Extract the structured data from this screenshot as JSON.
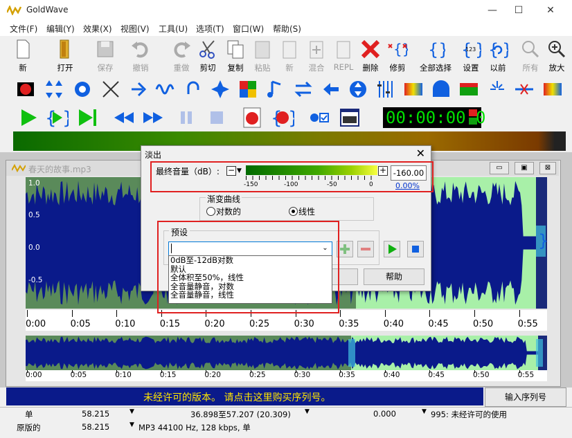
{
  "window": {
    "title": "GoldWave"
  },
  "menu": [
    "文件(F)",
    "编辑(Y)",
    "效果(X)",
    "视图(V)",
    "工具(U)",
    "选项(T)",
    "窗口(W)",
    "帮助(S)"
  ],
  "toolbar": [
    {
      "label": "新",
      "icon": "new-file-icon",
      "enabled": true
    },
    {
      "label": "打开",
      "icon": "open-folder-icon",
      "enabled": true
    },
    {
      "label": "保存",
      "icon": "save-icon",
      "enabled": false
    },
    {
      "label": "撤销",
      "icon": "undo-icon",
      "enabled": false
    },
    {
      "label": "重做",
      "icon": "redo-icon",
      "enabled": false
    },
    {
      "label": "剪切",
      "icon": "scissors-icon",
      "enabled": true
    },
    {
      "label": "复制",
      "icon": "copy-icon",
      "enabled": true
    },
    {
      "label": "粘贴",
      "icon": "paste-icon",
      "enabled": false
    },
    {
      "label": "新",
      "icon": "paste-new-icon",
      "enabled": false
    },
    {
      "label": "混合",
      "icon": "mix-icon",
      "enabled": false
    },
    {
      "label": "REPL",
      "icon": "replace-icon",
      "enabled": false
    },
    {
      "label": "删除",
      "icon": "delete-x-icon",
      "enabled": true
    },
    {
      "label": "修剪",
      "icon": "trim-icon",
      "enabled": true
    },
    {
      "label": "全部选择",
      "icon": "select-all-icon",
      "enabled": true
    },
    {
      "label": "设置",
      "icon": "set-icon",
      "enabled": true
    },
    {
      "label": "以前",
      "icon": "previous-icon",
      "enabled": true
    },
    {
      "label": "所有",
      "icon": "zoom-all-icon",
      "enabled": false
    },
    {
      "label": "放大",
      "icon": "zoom-in-icon",
      "enabled": true
    }
  ],
  "timer": "00:00:00.0",
  "document": {
    "title": "春天的故事.mp3"
  },
  "wave_scale": [
    "1.0",
    "0.5",
    "0.0",
    "-0.5"
  ],
  "time_ruler": [
    "0:00",
    "0:05",
    "0:10",
    "0:15",
    "0:20",
    "0:25",
    "0:30",
    "0:35",
    "0:40",
    "0:45",
    "0:50",
    "0:55"
  ],
  "dialog": {
    "title": "淡出",
    "final_volume_label": "最终音量（dB）:",
    "slider_ticks": [
      "-150",
      "-100",
      "-50",
      "0"
    ],
    "value": "-160.00",
    "percent": "0.00%",
    "curve_label": "渐变曲线",
    "curve_options": [
      "对数的",
      "线性"
    ],
    "curve_selected": "线性",
    "preset_label": "预设",
    "preset_value": "",
    "preset_options": [
      "0dB至-12dB对数",
      "默认",
      "全体积至50%，线性",
      "全音量静音，对数",
      "全音量静音，线性"
    ],
    "help_button": "帮助"
  },
  "register": {
    "banner": "未经许可的版本。 请点击这里购买序列号。",
    "button": "输入序列号"
  },
  "status": {
    "row1": {
      "channel": "单",
      "duration": "58.215",
      "selection": "36.898至57.207 (20.309)",
      "position": "0.000",
      "license": "995: 未经许可的使用"
    },
    "row2": {
      "label": "原版的",
      "duration": "58.215",
      "format": "MP3 44100 Hz, 128 kbps, 单"
    }
  },
  "colors": {
    "wave_bg": "#5a8a5a",
    "wave_selected": "#a8f0a8",
    "wave_line": "#0a1a8a",
    "banner_bg": "#0a1a8a",
    "banner_text": "#ffe600",
    "highlight_red": "#e02020"
  }
}
